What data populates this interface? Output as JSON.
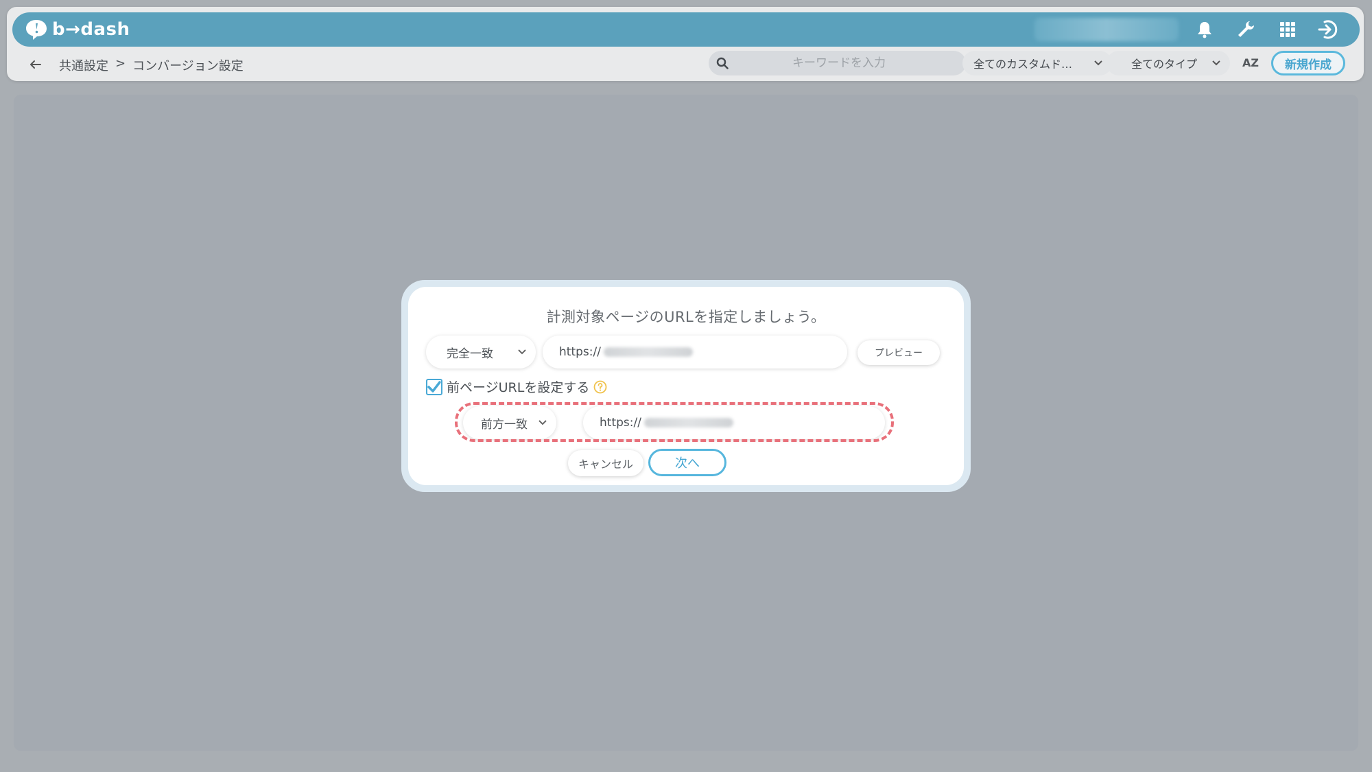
{
  "app": {
    "logo_text": "b→dash"
  },
  "header": {
    "icons": [
      "bell-icon",
      "wrench-icon",
      "grid-icon",
      "logout-icon"
    ],
    "accent": "#5ba1bc"
  },
  "breadcrumb": {
    "parent": "共通設定",
    "separator": ">",
    "current": "コンバージョン設定"
  },
  "toolbar": {
    "search_placeholder": "キーワードを入力",
    "custom_filter": "全てのカスタムド…",
    "type_filter": "全てのタイプ",
    "sort_label": "AZ",
    "new_button": "新規作成"
  },
  "modal": {
    "title": "計測対象ページのURLを指定しましょう。",
    "match_type": "完全一致",
    "url_prefix": "https://",
    "preview_button": "プレビュー",
    "checkbox_label": "前ページURLを設定する",
    "checkbox_checked": true,
    "prev_match_type": "前方一致",
    "prev_url_prefix": "https://",
    "cancel_button": "キャンセル",
    "next_button": "次へ"
  },
  "colors": {
    "highlight": "#e8707a",
    "primary_button": "#56b6dd"
  }
}
